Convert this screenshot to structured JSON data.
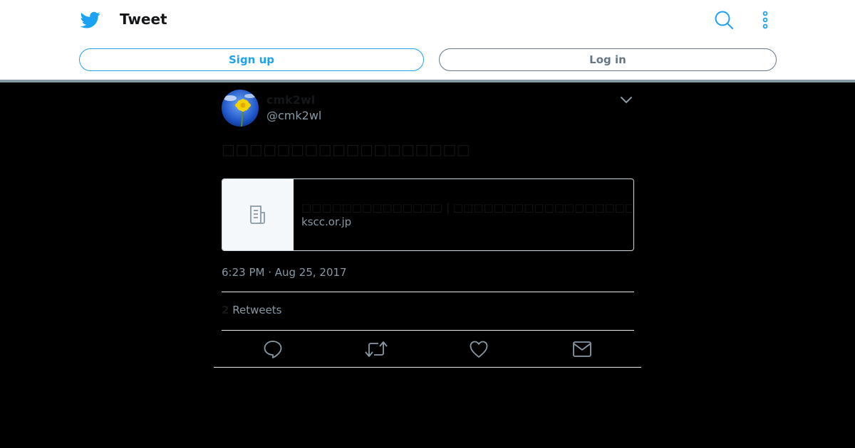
{
  "header": {
    "title": "Tweet",
    "signup_label": "Sign up",
    "login_label": "Log in",
    "icons": [
      "twitter-bird-icon",
      "search-icon",
      "more-options-icon"
    ]
  },
  "tweet": {
    "display_name": "cmk2wl",
    "handle": "@cmk2wl",
    "text": "□□□□□□□□□□□□□□□□□□",
    "card": {
      "title": "□□□□□□□□□□□□□□ | □□□□□□□□□□□□□□□□□□□□□□□",
      "domain": "kscc.or.jp",
      "icon": "article-icon"
    },
    "timestamp": "6:23 PM · Aug 25, 2017",
    "retweet_count": "2",
    "retweets_label": "Retweets",
    "actions": [
      "reply-icon",
      "retweet-icon",
      "like-icon",
      "direct-message-icon"
    ]
  },
  "colors": {
    "accent": "#1da1f2",
    "muted": "#8899a6",
    "text_dark": "#14171a",
    "background": "#000000"
  }
}
